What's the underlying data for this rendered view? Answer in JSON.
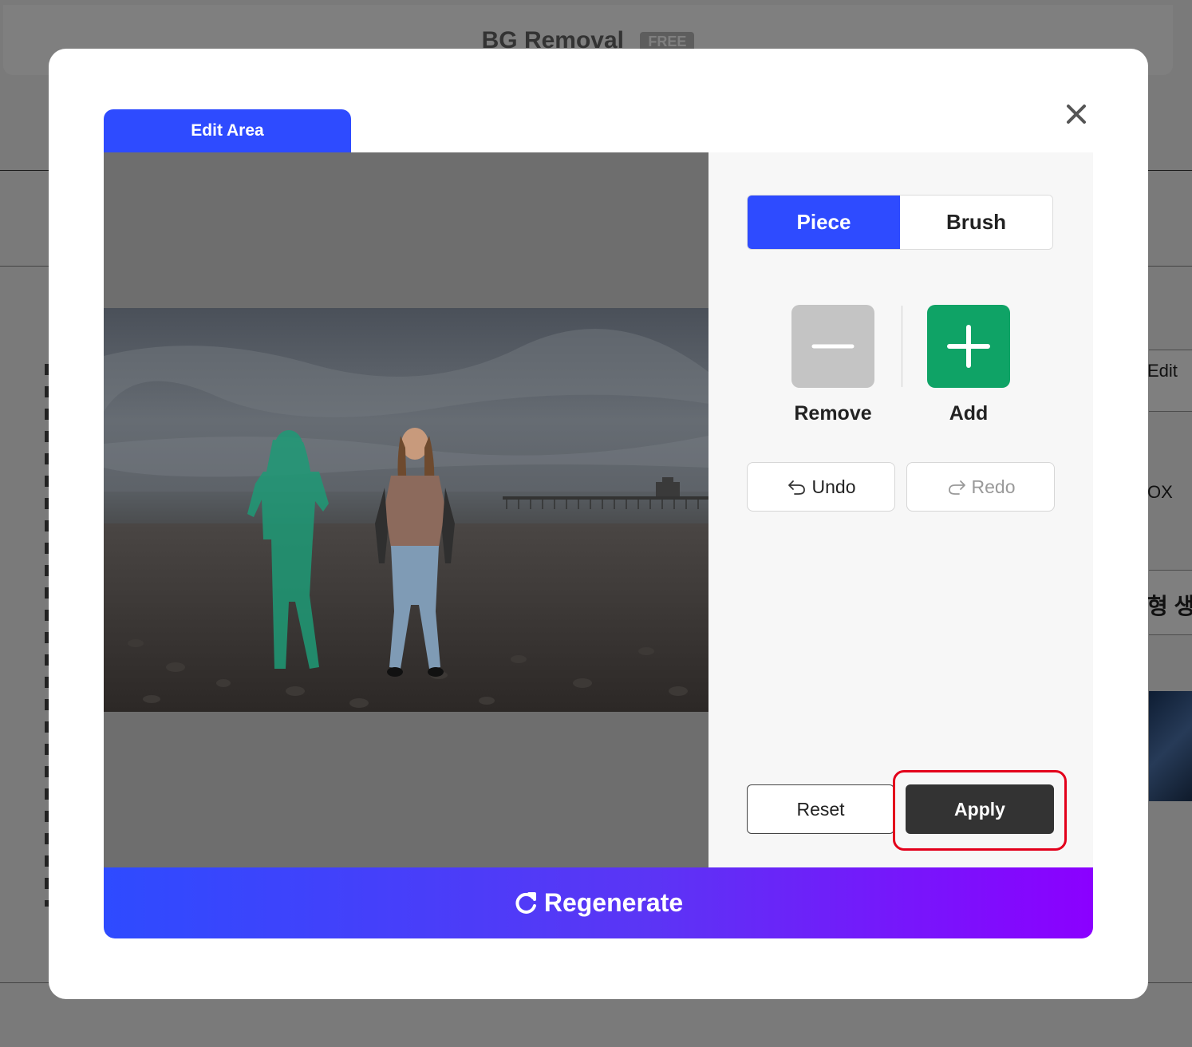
{
  "background": {
    "header_title": "BG Removal",
    "header_badge": "FREE",
    "right_text_1": "Edit",
    "right_text_2": "OX",
    "right_text_3": "형 생성"
  },
  "modal": {
    "tab_label": "Edit Area",
    "close_icon": "close-icon",
    "mode_options": [
      "Piece",
      "Brush"
    ],
    "selected_mode": "Piece",
    "tools": {
      "remove_label": "Remove",
      "add_label": "Add"
    },
    "history": {
      "undo_label": "Undo",
      "redo_label": "Redo"
    },
    "actions": {
      "reset_label": "Reset",
      "apply_label": "Apply"
    },
    "regenerate_label": "Regenerate"
  },
  "colors": {
    "primary": "#2e4bff",
    "add_green": "#0fa366",
    "remove_gray": "#c4c4c4",
    "apply_dark": "#333333",
    "highlight_red": "#e3001b",
    "gradient_end": "#8b00ff"
  }
}
